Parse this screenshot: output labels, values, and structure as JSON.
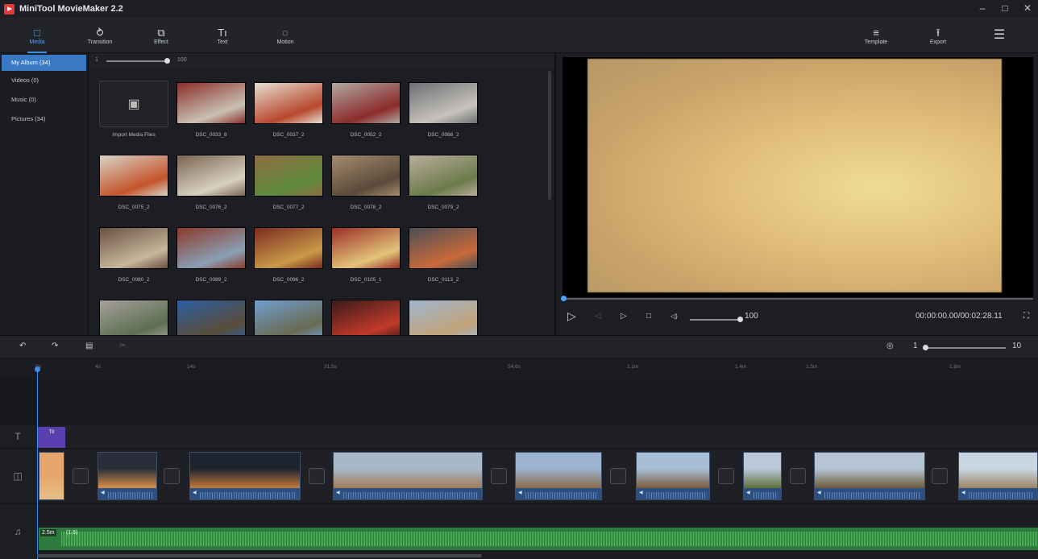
{
  "app": {
    "title": "MiniTool MovieMaker 2.2"
  },
  "window_controls": [
    "–",
    "□",
    "✕"
  ],
  "toolbar": {
    "items": [
      {
        "label": "Media",
        "icon": "folder-icon",
        "glyph": "□",
        "active": true
      },
      {
        "label": "Transition",
        "icon": "transition-icon",
        "glyph": "⥁",
        "active": false
      },
      {
        "label": "Effect",
        "icon": "effect-icon",
        "glyph": "⧉",
        "active": false
      },
      {
        "label": "Text",
        "icon": "text-icon",
        "glyph": "Tı",
        "active": false
      },
      {
        "label": "Motion",
        "icon": "motion-icon",
        "glyph": "◌",
        "active": false
      }
    ],
    "right_items": [
      {
        "label": "Template",
        "icon": "template-icon",
        "glyph": "≡"
      },
      {
        "label": "Export",
        "icon": "export-icon",
        "glyph": "⭱"
      }
    ],
    "menu_glyph": "☰"
  },
  "sidebar": {
    "items": [
      {
        "label": "My Album (34)",
        "active": true
      },
      {
        "label": "Videos (0)",
        "active": false
      },
      {
        "label": "Music (0)",
        "active": false
      },
      {
        "label": "Pictures (34)",
        "active": false
      }
    ]
  },
  "media": {
    "size_min": "1",
    "size_max": "100",
    "import_label": "Import Media Files",
    "thumbs": [
      {
        "label": "DSC_0033_8",
        "c1": "#8a2e2a",
        "c2": "#c9c1b3"
      },
      {
        "label": "DSC_0037_2",
        "c1": "#e6e0d5",
        "c2": "#b8472c"
      },
      {
        "label": "DSC_0052_2",
        "c1": "#b0a9a2",
        "c2": "#8c2b2b"
      },
      {
        "label": "DSC_0066_2",
        "c1": "#6d6f73",
        "c2": "#c7c3bc"
      },
      {
        "label": "DSC_0075_2",
        "c1": "#d9d3c7",
        "c2": "#c4542a"
      },
      {
        "label": "DSC_0076_2",
        "c1": "#7a6552",
        "c2": "#d8d0c0"
      },
      {
        "label": "DSC_0077_2",
        "c1": "#8f6d45",
        "c2": "#5d8a3a"
      },
      {
        "label": "DSC_0078_2",
        "c1": "#a48c6e",
        "c2": "#5b4a3a"
      },
      {
        "label": "DSC_0079_2",
        "c1": "#b9ae9c",
        "c2": "#6c7a4a"
      },
      {
        "label": "DSC_0080_2",
        "c1": "#6a5140",
        "c2": "#c7b79d"
      },
      {
        "label": "DSC_0089_2",
        "c1": "#8b3a2c",
        "c2": "#8aa0b5"
      },
      {
        "label": "DSC_0096_2",
        "c1": "#7c2a22",
        "c2": "#c89a48"
      },
      {
        "label": "DSC_0105_1",
        "c1": "#9b2e25",
        "c2": "#e3c47a"
      },
      {
        "label": "DSC_0113_2",
        "c1": "#4b4e56",
        "c2": "#c96a3a"
      },
      {
        "label": "",
        "c1": "#a6a09a",
        "c2": "#5c6f52"
      },
      {
        "label": "",
        "c1": "#2b5fa0",
        "c2": "#5a4c3a"
      },
      {
        "label": "",
        "c1": "#6f9fd1",
        "c2": "#6a6a52"
      },
      {
        "label": "",
        "c1": "#3a1a1a",
        "c2": "#c23a2a"
      },
      {
        "label": "",
        "c1": "#9fb6cf",
        "c2": "#c2a37a"
      }
    ]
  },
  "preview": {
    "volume": "100",
    "timecode": "00:00:00.00/00:02:28.11",
    "play_glyph": "▷",
    "prev_glyph": "◁",
    "next_glyph": "▷",
    "stop_glyph": "□",
    "vol_glyph": "◁)",
    "fullscreen_glyph": "⛶"
  },
  "timeline": {
    "undo": "↶",
    "redo": "↷",
    "delete": "▤",
    "split": "✂",
    "fit_glyph": "◎",
    "zoom_min": "1",
    "zoom_max": "10",
    "ruler": [
      "0s",
      "4s",
      "14s",
      "31.5s",
      "54.6s",
      "1.1m",
      "1.4m",
      "1.5m",
      "1.8m"
    ],
    "text_clip": "Tit",
    "clips": [
      {
        "c1": "#e6a56a",
        "c2": "#e6c08a"
      },
      {
        "c1": "#2a2e3a",
        "c2": "#d9904a"
      },
      {
        "c1": "#1e2330",
        "c2": "#c27c3a"
      },
      {
        "c1": "#a7b8c8",
        "c2": "#a27a56"
      },
      {
        "c1": "#9bb3cf",
        "c2": "#8a6a4a"
      },
      {
        "c1": "#a6bfd6",
        "c2": "#7a5a3a"
      },
      {
        "c1": "#b9c9d8",
        "c2": "#5f6f3a"
      },
      {
        "c1": "#b5c5d4",
        "c2": "#6b5a3a"
      },
      {
        "c1": "#c9d6e2",
        "c2": "#9b8366"
      }
    ],
    "music_duration": "2.5m",
    "music_name": "(1.6)"
  },
  "colors": {
    "accent": "#3a8fe8",
    "text_clip": "#5a3fb0",
    "music_clip": "#2f7a3e"
  }
}
